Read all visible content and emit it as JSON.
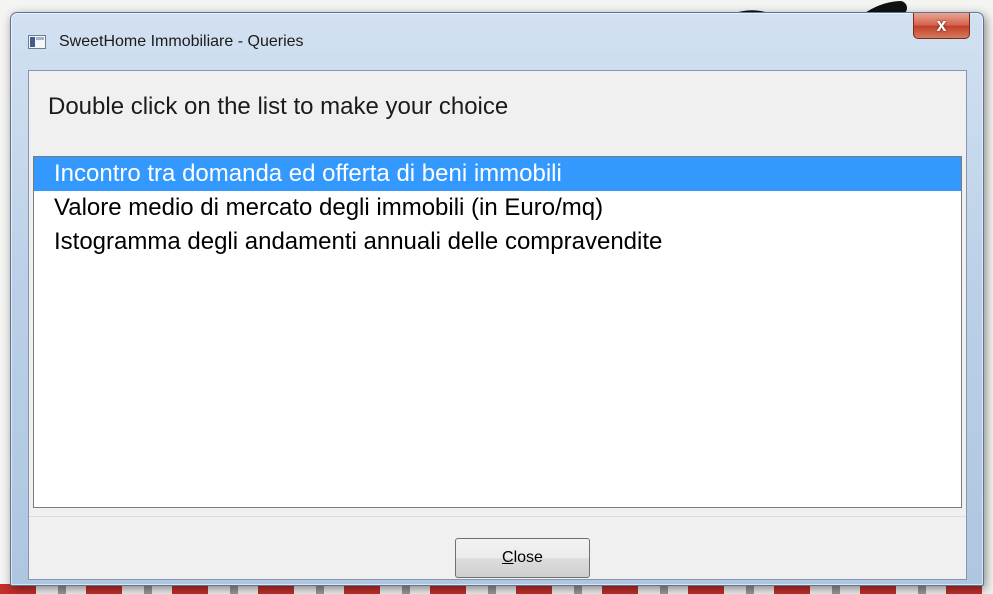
{
  "window": {
    "title": "SweetHome Immobiliare - Queries",
    "close_glyph": "x"
  },
  "dialog": {
    "instruction": "Double click on the list to make your choice",
    "list_items": [
      {
        "label": "Incontro tra domanda ed offerta di beni immobili",
        "selected": true
      },
      {
        "label": "Valore medio di mercato degli immobili (in Euro/mq)",
        "selected": false
      },
      {
        "label": "Istogramma degli andamenti annuali delle compravendite",
        "selected": false
      }
    ],
    "close_button": {
      "mnemonic": "C",
      "rest": "lose"
    }
  },
  "colors": {
    "selection": "#3399ff",
    "titlebar": "#bcd1e8",
    "close_red": "#c1402a"
  },
  "icons": {
    "app": "app-window-icon",
    "close": "close-icon"
  }
}
